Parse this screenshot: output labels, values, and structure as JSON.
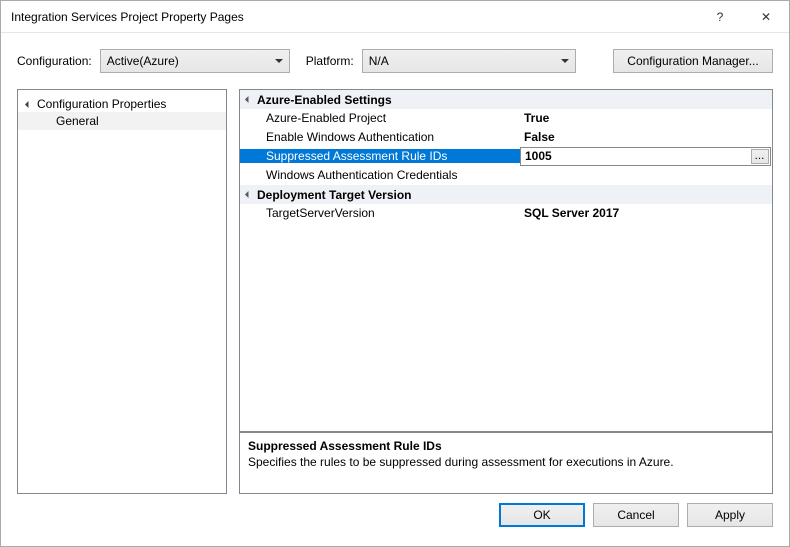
{
  "dialog": {
    "title": "Integration Services Project Property Pages"
  },
  "configRow": {
    "configurationLabel": "Configuration:",
    "configurationValue": "Active(Azure)",
    "platformLabel": "Platform:",
    "platformValue": "N/A",
    "configManagerLabel": "Configuration Manager..."
  },
  "tree": {
    "root": "Configuration Properties",
    "child": "General"
  },
  "propGrid": {
    "categories": [
      {
        "label": "Azure-Enabled Settings",
        "rows": [
          {
            "name": "Azure-Enabled Project",
            "value": "True",
            "bold": true,
            "selected": false
          },
          {
            "name": "Enable Windows Authentication",
            "value": "False",
            "bold": true,
            "selected": false
          },
          {
            "name": "Suppressed Assessment Rule IDs",
            "value": "1005",
            "bold": true,
            "selected": true,
            "ellipsis": true
          },
          {
            "name": "Windows Authentication Credentials",
            "value": "",
            "bold": false,
            "selected": false
          }
        ]
      },
      {
        "label": "Deployment Target Version",
        "rows": [
          {
            "name": "TargetServerVersion",
            "value": "SQL Server 2017",
            "bold": true,
            "selected": false
          }
        ]
      }
    ]
  },
  "description": {
    "title": "Suppressed Assessment Rule IDs",
    "text": "Specifies the rules to be suppressed during assessment for executions in Azure."
  },
  "buttons": {
    "ok": "OK",
    "cancel": "Cancel",
    "apply": "Apply"
  },
  "icons": {
    "help": "?",
    "close": "✕",
    "ellipsis": "..."
  }
}
